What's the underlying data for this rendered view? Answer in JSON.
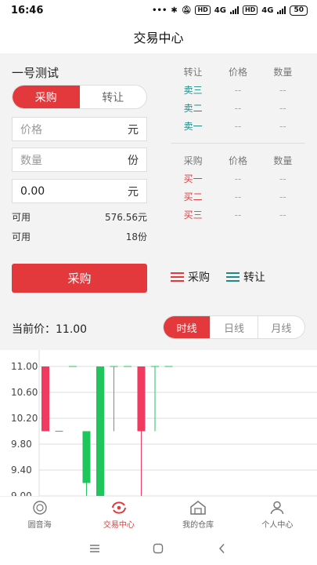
{
  "status": {
    "time": "16:46",
    "battery": "50",
    "net1": "4G",
    "net2": "4G",
    "hd": "HD"
  },
  "header": {
    "title": "交易中心"
  },
  "trade": {
    "product_name": "一号测试",
    "mode_tabs": [
      "采购",
      "转让"
    ],
    "price_placeholder": "价格",
    "price_unit": "元",
    "qty_placeholder": "数量",
    "qty_unit": "份",
    "amount_value": "0.00",
    "amount_unit": "元",
    "available_label": "可用",
    "available_money": "576.56元",
    "available_qty": "18份",
    "submit_label": "采购"
  },
  "orderbook": {
    "sell_headers": [
      "转让",
      "价格",
      "数量"
    ],
    "sell_rows": [
      [
        "卖三",
        "--",
        "--"
      ],
      [
        "卖二",
        "--",
        "--"
      ],
      [
        "卖一",
        "--",
        "--"
      ]
    ],
    "buy_headers": [
      "采购",
      "价格",
      "数量"
    ],
    "buy_rows": [
      [
        "买一",
        "--",
        "--"
      ],
      [
        "买二",
        "--",
        "--"
      ],
      [
        "买三",
        "--",
        "--"
      ]
    ]
  },
  "legend": {
    "buy": "采购",
    "sell": "转让"
  },
  "market": {
    "current_price_label": "当前价：11.00",
    "timeframes": [
      "时线",
      "日线",
      "月线"
    ]
  },
  "colors": {
    "accent": "#e4393c",
    "up": "#f03a5f",
    "down": "#1fc65c",
    "teal": "#1d8a85"
  },
  "chart_data": {
    "type": "candlestick",
    "y_ticks": [
      "11.00",
      "10.60",
      "10.20",
      "9.80",
      "9.40",
      "9.00"
    ],
    "ylim": [
      9.0,
      11.0
    ],
    "candles": [
      {
        "open": 11.0,
        "close": 10.0,
        "high": 11.0,
        "low": 10.0,
        "color": "up"
      },
      {
        "open": 10.0,
        "close": 10.0,
        "high": 10.0,
        "low": 10.0,
        "color": "down"
      },
      {
        "open": 11.0,
        "close": 11.0,
        "high": 11.0,
        "low": 11.0,
        "color": "down"
      },
      {
        "open": 9.2,
        "close": 10.0,
        "high": 10.0,
        "low": 8.8,
        "color": "down"
      },
      {
        "open": 11.0,
        "close": 8.8,
        "high": 11.0,
        "low": 8.8,
        "color": "down"
      },
      {
        "open": 11.0,
        "close": 11.0,
        "high": 11.0,
        "low": 10.0,
        "color": "down"
      },
      {
        "open": 11.0,
        "close": 11.0,
        "high": 11.0,
        "low": 11.0,
        "color": "down"
      },
      {
        "open": 11.0,
        "close": 10.0,
        "high": 11.0,
        "low": 8.8,
        "color": "up"
      },
      {
        "open": 11.0,
        "close": 11.0,
        "high": 11.0,
        "low": 10.0,
        "color": "down"
      },
      {
        "open": 11.0,
        "close": 11.0,
        "high": 11.0,
        "low": 11.0,
        "color": "down"
      }
    ]
  },
  "tabs": [
    {
      "label": "圆音海",
      "icon": "circle-logo-icon"
    },
    {
      "label": "交易中心",
      "icon": "exchange-icon"
    },
    {
      "label": "我的仓库",
      "icon": "warehouse-icon"
    },
    {
      "label": "个人中心",
      "icon": "user-icon"
    }
  ]
}
